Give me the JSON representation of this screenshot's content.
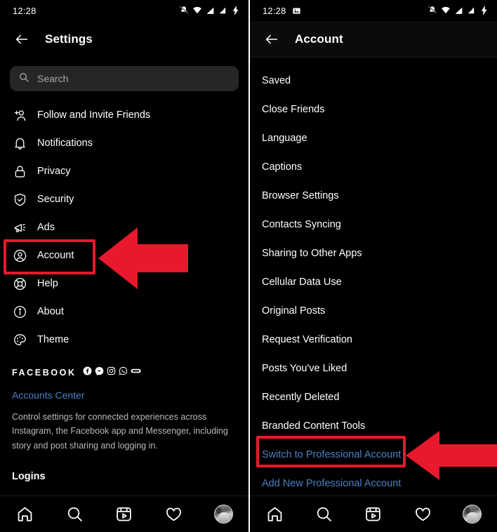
{
  "left": {
    "statusbar": {
      "time": "12:28",
      "icons": [
        "bell-muted-icon",
        "wifi-icon",
        "signal-icon",
        "signal-x-icon",
        "charging-bolt-icon"
      ]
    },
    "header": {
      "title": "Settings",
      "back": "back-arrow-icon"
    },
    "search": {
      "placeholder": "Search",
      "icon": "search-icon"
    },
    "menu": [
      {
        "label": "Follow and Invite Friends",
        "icon": "person-add-icon"
      },
      {
        "label": "Notifications",
        "icon": "bell-icon"
      },
      {
        "label": "Privacy",
        "icon": "lock-icon"
      },
      {
        "label": "Security",
        "icon": "shield-check-icon"
      },
      {
        "label": "Ads",
        "icon": "megaphone-icon"
      },
      {
        "label": "Account",
        "icon": "account-circle-icon"
      },
      {
        "label": "Help",
        "icon": "life-ring-icon"
      },
      {
        "label": "About",
        "icon": "info-circle-icon"
      },
      {
        "label": "Theme",
        "icon": "palette-icon"
      }
    ],
    "facebook": {
      "word": "FACEBOOK",
      "brand_icons": [
        "facebook-icon",
        "messenger-icon",
        "instagram-icon",
        "whatsapp-icon",
        "portal-icon"
      ],
      "accounts_center": "Accounts Center",
      "description": "Control settings for connected experiences across Instagram, the Facebook app and Messenger, including story and post sharing and logging in.",
      "logins": "Logins"
    }
  },
  "right": {
    "statusbar": {
      "time": "12:28",
      "icons": [
        "image-icon",
        "bell-muted-icon",
        "wifi-icon",
        "signal-icon",
        "signal-x-icon",
        "charging-bolt-icon"
      ]
    },
    "header": {
      "title": "Account",
      "back": "back-arrow-icon"
    },
    "items": [
      {
        "label": "Saved",
        "style": "normal"
      },
      {
        "label": "Close Friends",
        "style": "normal"
      },
      {
        "label": "Language",
        "style": "normal"
      },
      {
        "label": "Captions",
        "style": "normal"
      },
      {
        "label": "Browser Settings",
        "style": "normal"
      },
      {
        "label": "Contacts Syncing",
        "style": "normal"
      },
      {
        "label": "Sharing to Other Apps",
        "style": "normal"
      },
      {
        "label": "Cellular Data Use",
        "style": "normal"
      },
      {
        "label": "Original Posts",
        "style": "normal"
      },
      {
        "label": "Request Verification",
        "style": "normal"
      },
      {
        "label": "Posts You've Liked",
        "style": "normal"
      },
      {
        "label": "Recently Deleted",
        "style": "normal"
      },
      {
        "label": "Branded Content Tools",
        "style": "normal"
      },
      {
        "label": "Switch to Professional Account",
        "style": "blue"
      },
      {
        "label": "Add New Professional Account",
        "style": "blue"
      }
    ]
  },
  "bottom_nav": [
    {
      "icon": "home-icon"
    },
    {
      "icon": "search-icon"
    },
    {
      "icon": "reels-icon"
    },
    {
      "icon": "heart-icon"
    },
    {
      "icon": "profile-avatar"
    }
  ],
  "annotations": {
    "accent_color": "#e8192c",
    "left_highlight_target": "Account",
    "right_highlight_target": "Switch to Professional Account"
  }
}
